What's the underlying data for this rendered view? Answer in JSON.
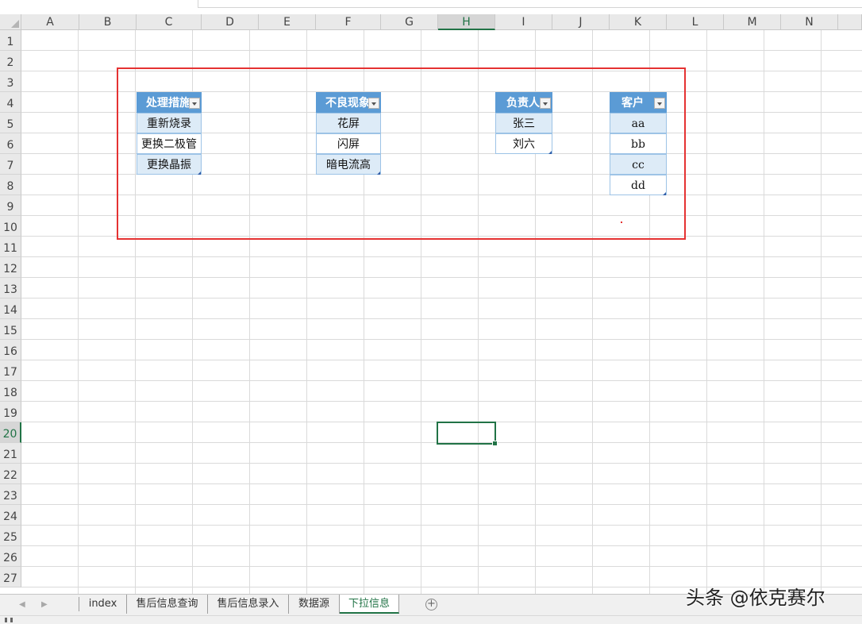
{
  "columns": [
    "A",
    "B",
    "C",
    "D",
    "E",
    "F",
    "G",
    "H",
    "I",
    "J",
    "K",
    "L",
    "M",
    "N"
  ],
  "rows": [
    "1",
    "2",
    "3",
    "4",
    "5",
    "6",
    "7",
    "8",
    "9",
    "10",
    "11",
    "12",
    "13",
    "14",
    "15",
    "16",
    "17",
    "18",
    "19",
    "20",
    "21",
    "22",
    "23",
    "24",
    "25",
    "26",
    "27"
  ],
  "selected_column": "H",
  "selected_row": "20",
  "tables": {
    "measures": {
      "header": "处理措施",
      "items": [
        "重新烧录",
        "更换二极管",
        "更换晶振"
      ]
    },
    "defects": {
      "header": "不良现象",
      "items": [
        "花屏",
        "闪屏",
        "暗电流高"
      ]
    },
    "owner": {
      "header": "负责人",
      "items": [
        "张三",
        "刘六"
      ]
    },
    "customer": {
      "header": "客户",
      "items": [
        "aa",
        "bb",
        "cc",
        "dd"
      ]
    }
  },
  "sheet_tabs": [
    "index",
    "售后信息查询",
    "售后信息录入",
    "数据源",
    "下拉信息"
  ],
  "active_tab": "下拉信息",
  "add_sheet_icon": "plus-circle-icon",
  "watermark": "头条 @依克赛尔",
  "colors": {
    "header_blue": "#5b9bd5",
    "band_blue": "#ddebf7",
    "excel_green": "#217346",
    "annotation_red": "#e53232"
  }
}
